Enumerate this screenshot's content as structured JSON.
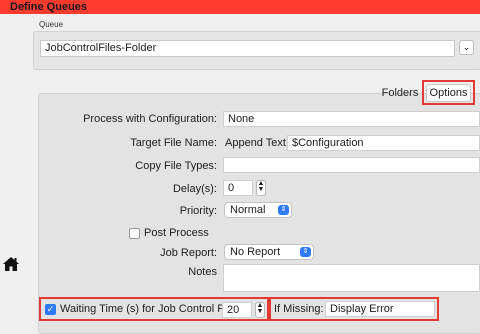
{
  "window": {
    "title": "Define Queues"
  },
  "queue": {
    "label": "Queue",
    "value": "JobControlFiles-Folder"
  },
  "tabs": {
    "folders": "Folders",
    "options": "Options"
  },
  "form": {
    "process_config_label": "Process with Configuration:",
    "process_config_value": "None",
    "target_file_label": "Target File Name:",
    "append_text_label": "Append Text:",
    "append_text_value": "$Configuration",
    "copy_types_label": "Copy File Types:",
    "copy_types_value": "",
    "delay_label": "Delay(s):",
    "delay_value": "0",
    "priority_label": "Priority:",
    "priority_value": "Normal",
    "post_process_label": "Post Process",
    "job_report_label": "Job Report:",
    "job_report_value": "No Report",
    "notes_label": "Notes",
    "waiting_label": "Waiting Time (s) for Job Control File",
    "waiting_value": "20",
    "if_missing_label": "If Missing:",
    "if_missing_value": "Display Error"
  },
  "colors": {
    "titlebar": "#ff3b30",
    "highlight": "#e53935",
    "accent": "#2f7af6"
  },
  "icons": {
    "home": "home-icon",
    "chevron": "chevron-down-icon",
    "stepper": "up-down-stepper-icon"
  }
}
